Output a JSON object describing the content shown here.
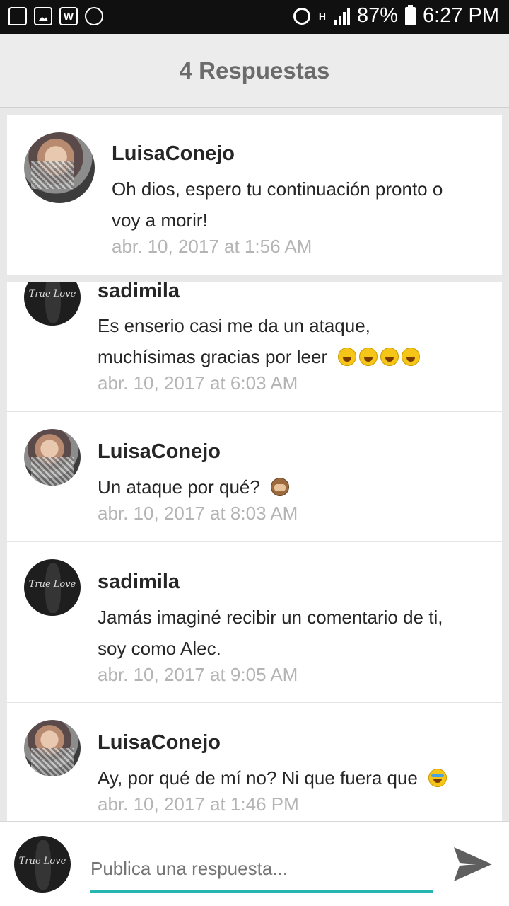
{
  "status_bar": {
    "battery": "87%",
    "time": "6:27 PM",
    "network": "H",
    "icons": [
      "chat-icon",
      "image-icon",
      "w-icon",
      "cloud-alert-icon",
      "alarm-icon",
      "signal-icon",
      "battery-icon"
    ]
  },
  "header": {
    "title": "4 Respuestas"
  },
  "main_comment": {
    "author": "LuisaConejo",
    "text_line1": "Oh dios, espero tu continuación pronto o",
    "text_line2": "voy a morir!",
    "time": "abr. 10, 2017 at 1:56 AM"
  },
  "replies": [
    {
      "author": "sadimila",
      "text_line1": "Es enserio casi me da un ataque,",
      "text_line2": "muchísimas gracias por leer",
      "emojis": 4,
      "time": "abr. 10, 2017 at 6:03 AM"
    },
    {
      "author": "LuisaConejo",
      "text_line1": "Un ataque por qué?",
      "time": "abr. 10, 2017 at 8:03 AM"
    },
    {
      "author": "sadimila",
      "text_line1": "Jamás imaginé recibir un comentario de ti,",
      "text_line2": "soy como Alec.",
      "time": "abr. 10, 2017 at 9:05 AM"
    },
    {
      "author": "LuisaConejo",
      "text_line1": "Ay, por qué de mí no? Ni que fuera que",
      "time": "abr. 10, 2017 at 1:46 PM"
    }
  ],
  "composer": {
    "placeholder": "Publica una respuesta..."
  },
  "avatar_text": "True Love",
  "colors": {
    "accent": "#27b5b0",
    "header_bg": "#ececec",
    "status_bg": "#101010"
  }
}
